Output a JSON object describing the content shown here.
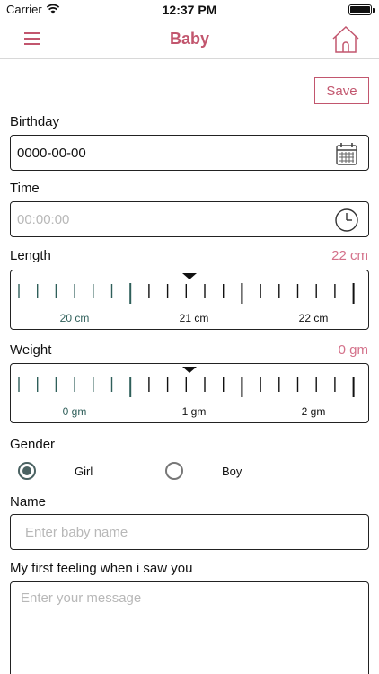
{
  "status_bar": {
    "carrier": "Carrier",
    "time": "12:37 PM"
  },
  "nav": {
    "title": "Baby",
    "menu_icon": "hamburger-icon",
    "home_icon": "home-icon"
  },
  "toolbar": {
    "save_label": "Save"
  },
  "birthday": {
    "label": "Birthday",
    "value": "0000-00-00",
    "icon": "calendar-icon"
  },
  "time": {
    "label": "Time",
    "placeholder": "00:00:00",
    "icon": "clock-icon"
  },
  "length": {
    "label": "Length",
    "value": "22 cm",
    "scale_labels": [
      "20 cm",
      "21 cm",
      "22 cm"
    ]
  },
  "weight": {
    "label": "Weight",
    "value": "0 gm",
    "scale_labels": [
      "0 gm",
      "1 gm",
      "2 gm"
    ]
  },
  "gender": {
    "label": "Gender",
    "options": [
      {
        "label": "Girl",
        "selected": true
      },
      {
        "label": "Boy",
        "selected": false
      }
    ]
  },
  "name": {
    "label": "Name",
    "placeholder": "Enter baby name"
  },
  "feeling": {
    "label": "My first feeling when i saw you",
    "placeholder": "Enter your message"
  },
  "colors": {
    "accent": "#c2566e",
    "value": "#d4718a",
    "ruler_past": "#2f5f5a",
    "radio": "#4a6262"
  }
}
